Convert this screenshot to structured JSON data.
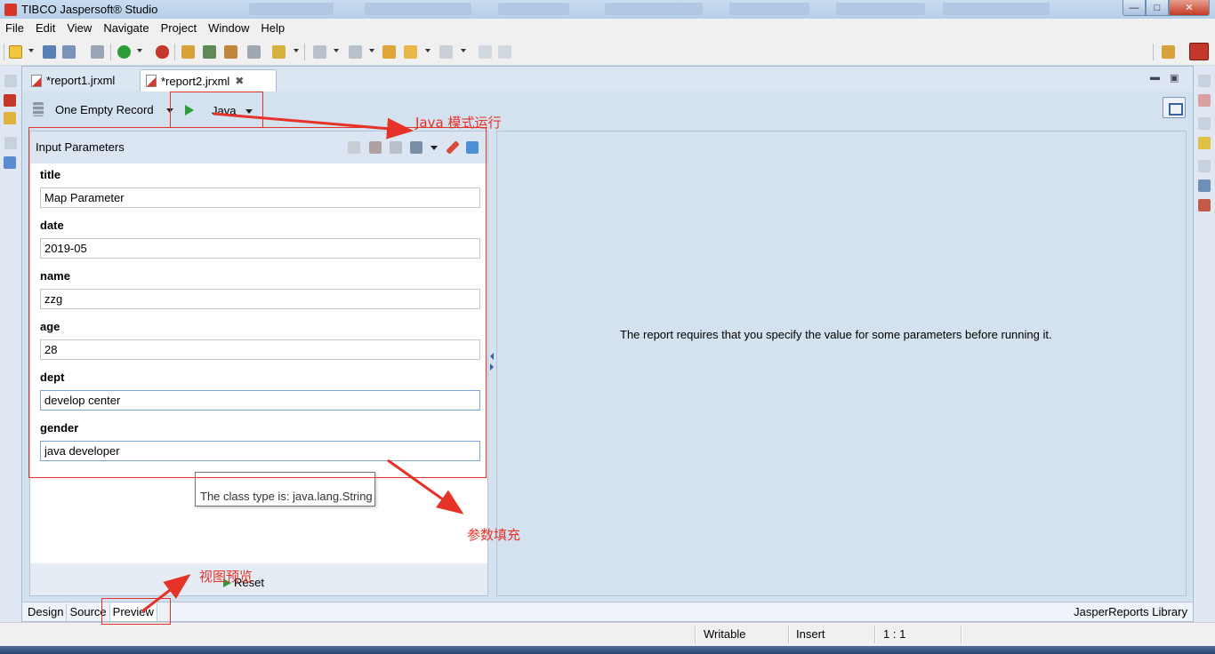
{
  "window": {
    "title": "TIBCO Jaspersoft® Studio"
  },
  "menu": [
    "File",
    "Edit",
    "View",
    "Navigate",
    "Project",
    "Window",
    "Help"
  ],
  "editor_tabs": [
    {
      "label": "*report1.jrxml",
      "active": false
    },
    {
      "label": "*report2.jrxml",
      "active": true
    }
  ],
  "preview_toolbar": {
    "data_adapter": "One Empty Record",
    "run_mode": "Java"
  },
  "params_panel": {
    "title": "Input Parameters",
    "params": [
      {
        "name": "title",
        "value": "Map Parameter"
      },
      {
        "name": "date",
        "value": "2019-05"
      },
      {
        "name": "name",
        "value": "zzg"
      },
      {
        "name": "age",
        "value": "28"
      },
      {
        "name": "dept",
        "value": "develop center"
      },
      {
        "name": "gender",
        "value": "java developer"
      }
    ],
    "tooltip": "The class type is: java.lang.String",
    "reset_label": "Reset"
  },
  "report_message": "The report requires that you specify the value for some parameters before running it.",
  "bottom_tabs": [
    {
      "label": "Design",
      "active": false
    },
    {
      "label": "Source",
      "active": false
    },
    {
      "label": "Preview",
      "active": true
    }
  ],
  "library_label": "JasperReports Library",
  "status": {
    "mode": "Writable",
    "insert": "Insert",
    "position": "1 : 1"
  },
  "annotations": {
    "java_mode": "Java 模式运行",
    "fill_params": "参数填充",
    "view_preview": "视图预览"
  },
  "colors": {
    "annotation": "#e5332a",
    "run_green": "#2e9b3a",
    "editor_bg": "#d4e1ef"
  }
}
